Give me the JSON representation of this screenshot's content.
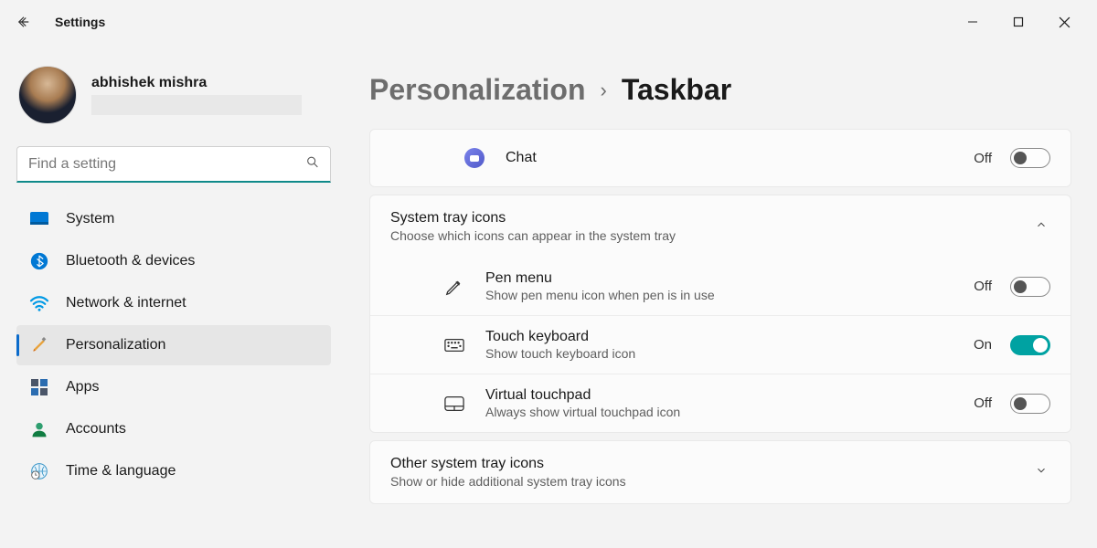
{
  "window": {
    "title": "Settings"
  },
  "profile": {
    "name": "abhishek mishra"
  },
  "search": {
    "placeholder": "Find a setting"
  },
  "nav": {
    "system": "System",
    "bluetooth": "Bluetooth & devices",
    "network": "Network & internet",
    "personalization": "Personalization",
    "apps": "Apps",
    "accounts": "Accounts",
    "time": "Time & language"
  },
  "breadcrumb": {
    "parent": "Personalization",
    "current": "Taskbar"
  },
  "rows": {
    "chat": {
      "title": "Chat",
      "state": "Off",
      "on": false
    },
    "tray_header": {
      "title": "System tray icons",
      "desc": "Choose which icons can appear in the system tray"
    },
    "pen": {
      "title": "Pen menu",
      "desc": "Show pen menu icon when pen is in use",
      "state": "Off",
      "on": false
    },
    "touchkb": {
      "title": "Touch keyboard",
      "desc": "Show touch keyboard icon",
      "state": "On",
      "on": true
    },
    "touchpad": {
      "title": "Virtual touchpad",
      "desc": "Always show virtual touchpad icon",
      "state": "Off",
      "on": false
    },
    "other": {
      "title": "Other system tray icons",
      "desc": "Show or hide additional system tray icons"
    }
  }
}
